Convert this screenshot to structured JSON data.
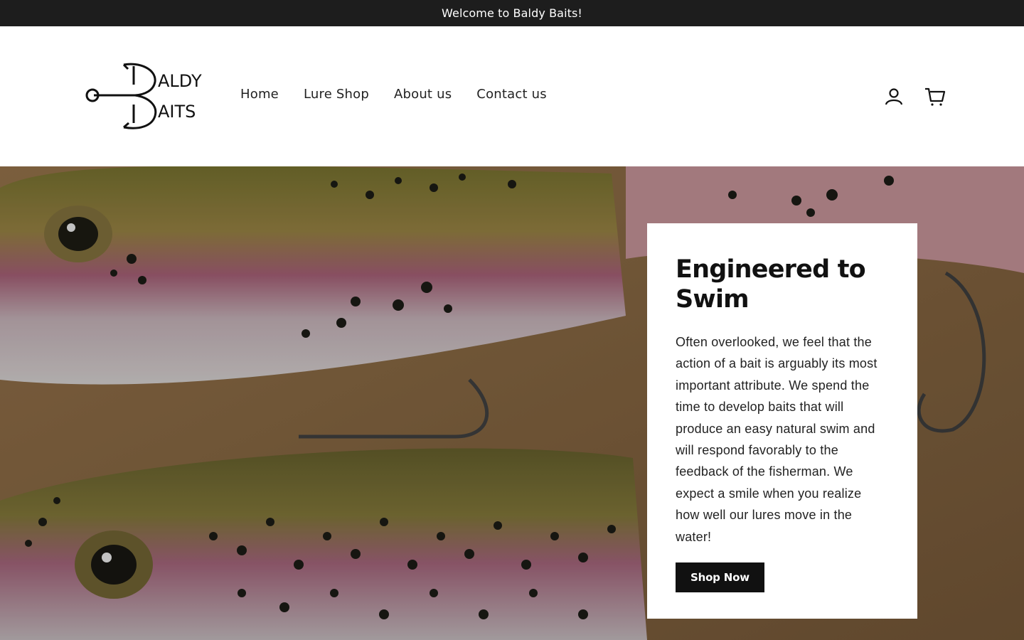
{
  "announcement": {
    "text": "Welcome to Baldy Baits!"
  },
  "header": {
    "logo": {
      "line1": "ALDY",
      "line2": "AITS"
    },
    "nav": [
      {
        "label": "Home"
      },
      {
        "label": "Lure Shop"
      },
      {
        "label": "About us"
      },
      {
        "label": "Contact us"
      }
    ],
    "icons": {
      "account": "user-icon",
      "cart": "cart-icon"
    }
  },
  "hero": {
    "card": {
      "title": "Engineered to Swim",
      "body": "Often overlooked, we feel that the action of a bait is arguably its most important attribute. We spend the time to develop baits that will produce an easy natural swim and will respond favorably to the feedback of the fisherman. We expect a smile when you realize how well our lures move in the water!",
      "button": "Shop Now"
    }
  },
  "colors": {
    "announcement_bg": "#1d1d1d",
    "button_bg": "#111111",
    "text": "#111111"
  }
}
